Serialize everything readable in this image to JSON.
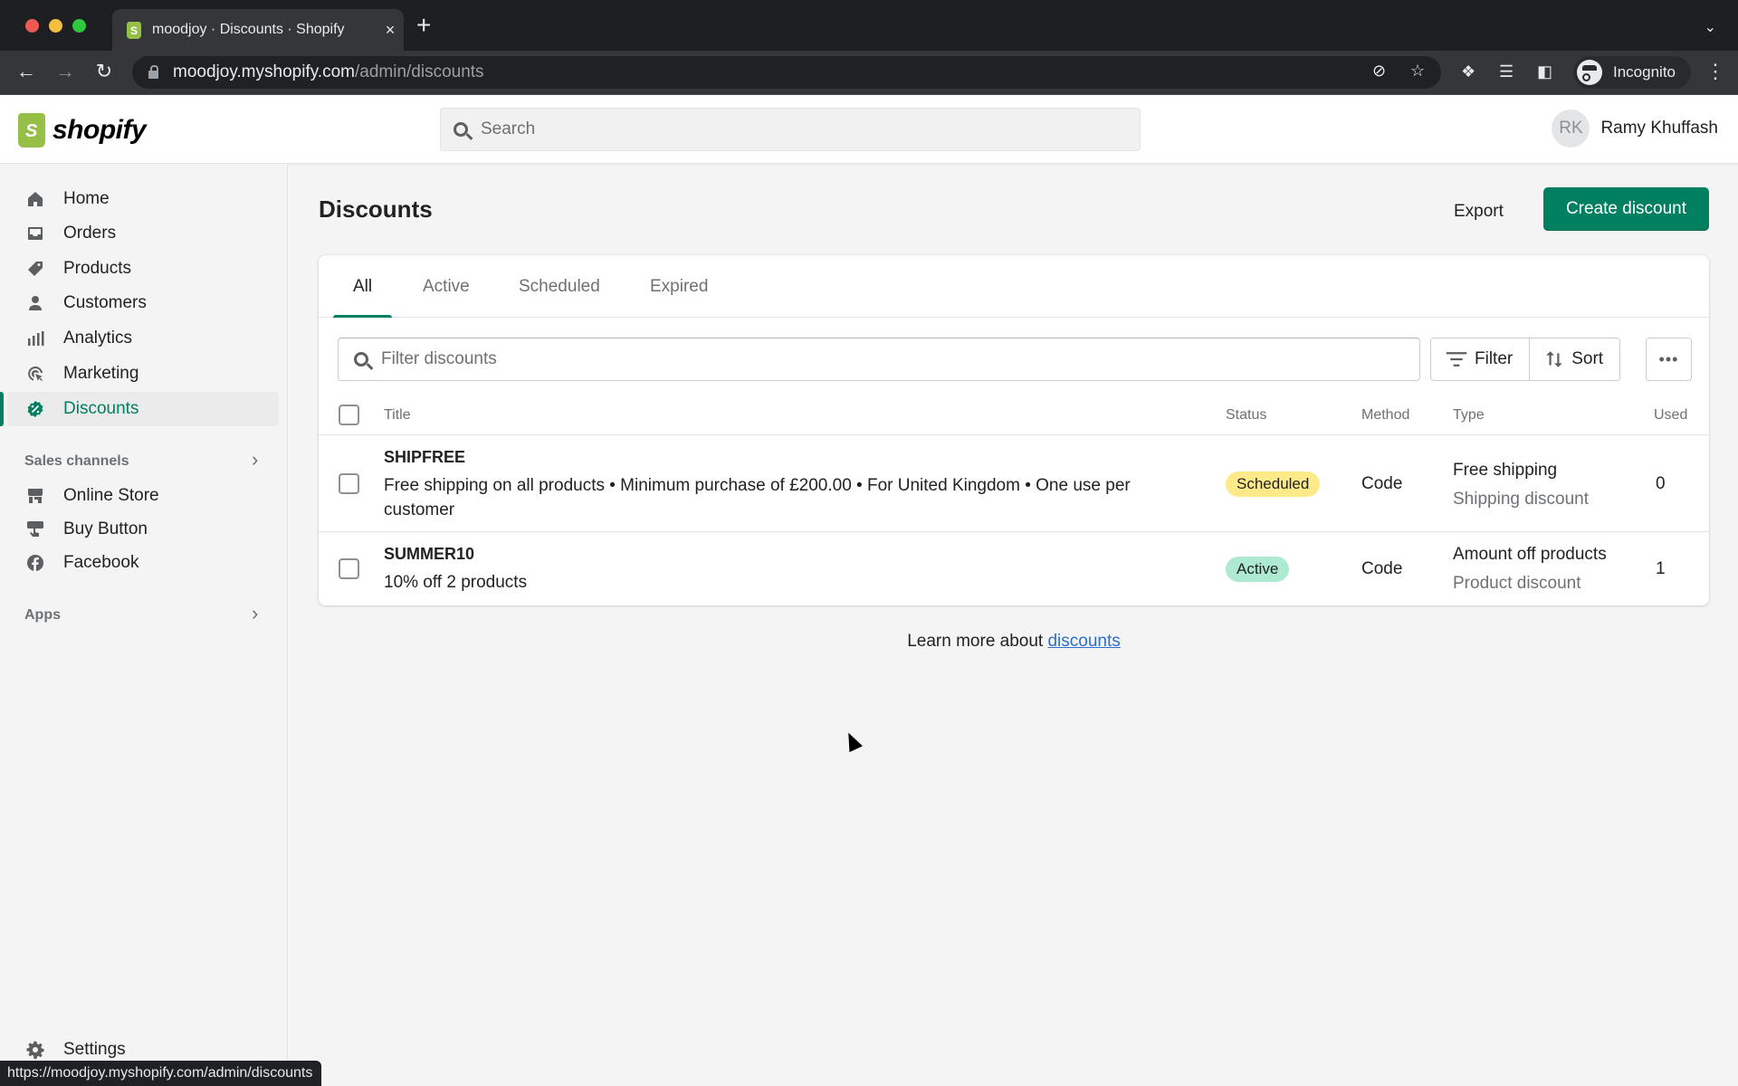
{
  "browser": {
    "tab_title": "moodjoy · Discounts · Shopify",
    "tab_close": "×",
    "new_tab": "+",
    "url_host": "moodjoy.myshopify.com",
    "url_path": "/admin/discounts",
    "profile_label": "Incognito",
    "status_url": "https://moodjoy.myshopify.com/admin/discounts"
  },
  "header": {
    "logo_text": "shopify",
    "search_placeholder": "Search",
    "user_initials": "RK",
    "user_name": "Ramy Khuffash"
  },
  "sidebar": {
    "items": [
      {
        "label": "Home",
        "icon": "home-icon"
      },
      {
        "label": "Orders",
        "icon": "orders-icon"
      },
      {
        "label": "Products",
        "icon": "tag-icon"
      },
      {
        "label": "Customers",
        "icon": "person-icon"
      },
      {
        "label": "Analytics",
        "icon": "bar-chart-icon"
      },
      {
        "label": "Marketing",
        "icon": "target-icon"
      },
      {
        "label": "Discounts",
        "icon": "discount-icon",
        "active": true
      }
    ],
    "sales_channels_label": "Sales channels",
    "channels": [
      {
        "label": "Online Store",
        "icon": "store-icon"
      },
      {
        "label": "Buy Button",
        "icon": "buy-button-icon"
      },
      {
        "label": "Facebook",
        "icon": "facebook-icon"
      }
    ],
    "apps_label": "Apps",
    "settings_label": "Settings"
  },
  "page": {
    "title": "Discounts",
    "export_label": "Export",
    "create_label": "Create discount",
    "accent_color": "#008060"
  },
  "tabs": [
    {
      "label": "All",
      "active": true
    },
    {
      "label": "Active"
    },
    {
      "label": "Scheduled"
    },
    {
      "label": "Expired"
    }
  ],
  "filter": {
    "placeholder": "Filter discounts",
    "filter_label": "Filter",
    "sort_label": "Sort",
    "more_label": "•••"
  },
  "table": {
    "columns": [
      "Title",
      "Status",
      "Method",
      "Type",
      "Used"
    ],
    "rows": [
      {
        "title": "SHIPFREE",
        "description": "Free shipping on all products • Minimum purchase of £200.00 • For United Kingdom • One use per customer",
        "status": "Scheduled",
        "status_color": "#ffea8a",
        "method": "Code",
        "type": "Free shipping",
        "subtype": "Shipping discount",
        "used": "0"
      },
      {
        "title": "SUMMER10",
        "description": "10% off 2 products",
        "status": "Active",
        "status_color": "#aee9d1",
        "method": "Code",
        "type": "Amount off products",
        "subtype": "Product discount",
        "used": "1"
      }
    ]
  },
  "footer": {
    "learn_prefix": "Learn more about ",
    "learn_link": "discounts"
  }
}
